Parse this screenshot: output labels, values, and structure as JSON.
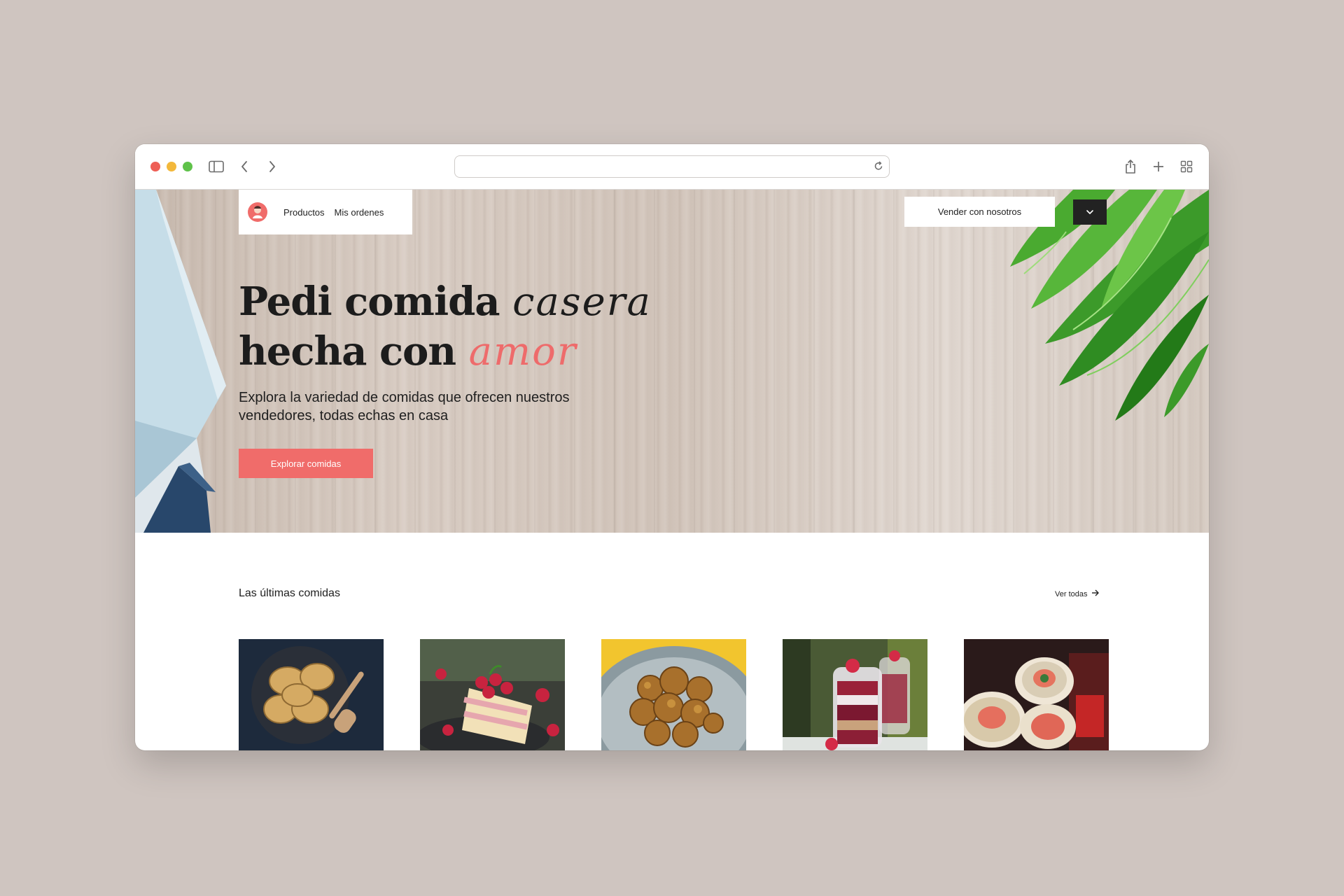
{
  "nav": {
    "products": "Productos",
    "orders": "Mis ordenes",
    "sell": "Vender con nosotros"
  },
  "hero": {
    "line1": "Pedi comida",
    "line1_script": "casera",
    "line2": "hecha con",
    "line2_script": "amor",
    "subtitle": "Explora la variedad de comidas que ofrecen nuestros vendedores, todas echas en casa",
    "cta": "Explorar comidas"
  },
  "latest": {
    "title": "Las últimas comidas",
    "see_all": "Ver todas"
  },
  "colors": {
    "accent": "#f06c6a",
    "dark_button": "#222222",
    "background": "#cfc5c0"
  },
  "icons": [
    "sidebar-icon",
    "back-icon",
    "forward-icon",
    "reload-icon",
    "share-icon",
    "plus-icon",
    "grid-icon",
    "chevron-down-icon",
    "arrow-right-icon"
  ]
}
